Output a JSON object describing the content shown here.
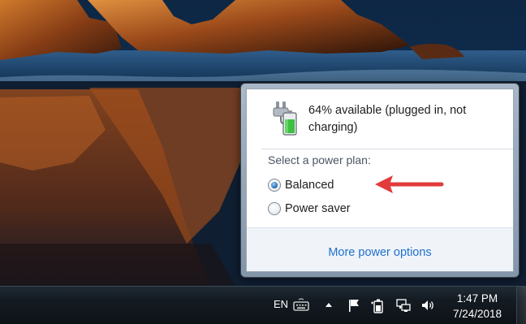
{
  "battery": {
    "status_line_1": "64% available (plugged in, not",
    "status_line_2": "charging)",
    "charge_percent": 64
  },
  "power_plan": {
    "heading": "Select a power plan:",
    "options": [
      {
        "label": "Balanced",
        "selected": true
      },
      {
        "label": "Power saver",
        "selected": false
      }
    ]
  },
  "footer": {
    "link_label": "More power options"
  },
  "taskbar": {
    "language": "EN",
    "tray_icons": [
      "keyboard-icon",
      "show-hidden-icons-chevron",
      "action-center-flag-icon",
      "battery-power-icon",
      "network-icon",
      "volume-icon"
    ],
    "clock": {
      "time": "1:47 PM",
      "date": "7/24/2018"
    }
  },
  "colors": {
    "link": "#1f6fcc",
    "annotation_arrow": "#e23b3b",
    "battery_fill": "#3fbf3f"
  }
}
